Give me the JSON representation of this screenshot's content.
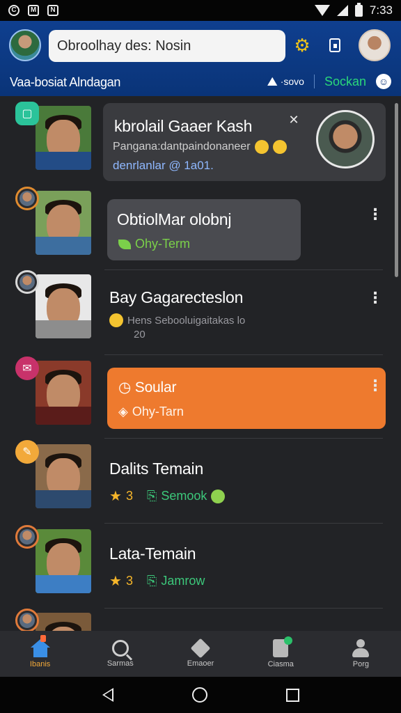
{
  "status_bar": {
    "time": "7:33"
  },
  "header": {
    "search_value": "Obroolhay des: Nosin",
    "subtitle": "Vaa-bosiat Alndagan",
    "pin_label": "·sovo",
    "socket_link": "Sockan"
  },
  "feed": [
    {
      "title": "kbrolail Gaaer Kash",
      "line1": "Pangana:dantpaindonaneer",
      "line2": "denrlanlar @ 1a01.",
      "badge_color": "#2bc39a",
      "card_style": "dark",
      "thumb_bg": "#4a7a3a",
      "body_color": "#234c86"
    },
    {
      "title": "ObtiolMar olobnj",
      "meta": "Ohy-Term",
      "badge_color": "#e08b2f",
      "card_style": "grey",
      "thumb_bg": "#7aa05a",
      "body_color": "#3d6e9f"
    },
    {
      "title": "Bay Gagarecteslon",
      "line1": "Hens Sebooluigaitakas lo",
      "line2": "20",
      "badge_color": "#d8d8d8",
      "card_style": "none",
      "thumb_bg": "#e8e8e8",
      "body_color": "#8d8d8d"
    },
    {
      "title": "Soular",
      "meta": "Ohy-Tarn",
      "badge_color": "#c8326a",
      "card_style": "orange",
      "thumb_bg": "#8a3a2a",
      "body_color": "#5a1c1a"
    },
    {
      "title": "Dalits Temain",
      "rating": "3",
      "tag": "Semook",
      "badge_color": "#f2a93a",
      "card_style": "none",
      "thumb_bg": "#8a6a4a",
      "body_color": "#2d4a6e"
    },
    {
      "title": "Lata-Temain",
      "rating": "3",
      "tag": "Jamrow",
      "badge_color": "#e07a3a",
      "card_style": "none",
      "thumb_bg": "#5a8a3a",
      "body_color": "#3d7ec4"
    }
  ],
  "bottom_nav": [
    {
      "label": "Ibanis"
    },
    {
      "label": "Sarmas"
    },
    {
      "label": "Emaoer"
    },
    {
      "label": "Ciasma"
    },
    {
      "label": "Porg"
    }
  ],
  "colors": {
    "header": "#0a3478",
    "accent_orange": "#ee7a2e",
    "accent_green": "#2bd87a"
  }
}
